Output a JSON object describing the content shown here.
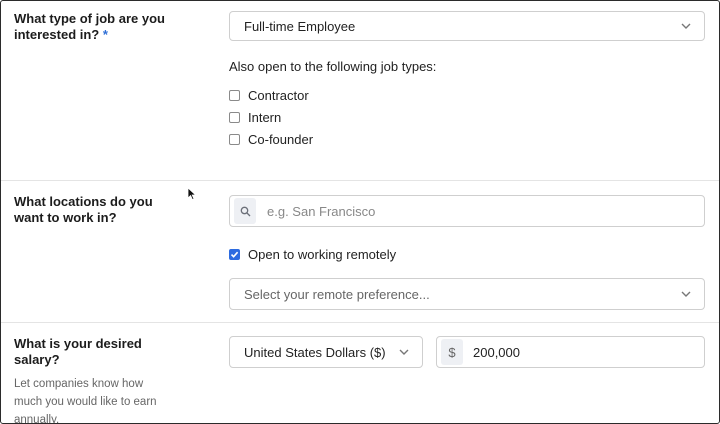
{
  "job_type": {
    "label": "What type of job are you interested in?",
    "required_mark": "*",
    "selected": "Full-time Employee",
    "also_open_label": "Also open to the following job types:",
    "options": [
      {
        "label": "Contractor",
        "checked": false
      },
      {
        "label": "Intern",
        "checked": false
      },
      {
        "label": "Co-founder",
        "checked": false
      }
    ]
  },
  "locations": {
    "label": "What locations do you want to work in?",
    "search_placeholder": "e.g. San Francisco",
    "remote_label": "Open to working remotely",
    "remote_checked": true,
    "remote_pref_placeholder": "Select your remote preference..."
  },
  "salary": {
    "label": "What is your desired salary?",
    "help": "Let companies know how much you would like to earn annually.",
    "currency": "United States Dollars ($)",
    "currency_symbol": "$",
    "amount": "200,000"
  },
  "colors": {
    "accent": "#2d6be0",
    "required": "#2f6fd6",
    "border": "#cfcfcf"
  }
}
